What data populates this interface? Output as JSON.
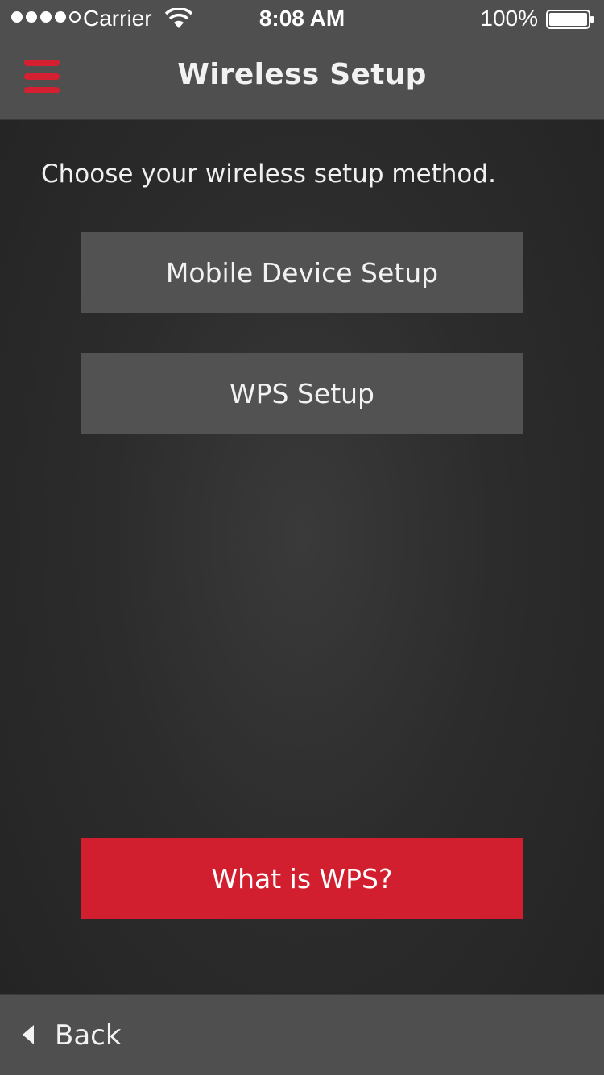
{
  "status_bar": {
    "carrier": "Carrier",
    "time": "8:08 AM",
    "battery": "100%",
    "signal_bars_filled": 4,
    "signal_bars_total": 5
  },
  "nav": {
    "title": "Wireless Setup",
    "menu_icon": "hamburger-menu-icon"
  },
  "content": {
    "instruction": "Choose your wireless setup method.",
    "mobile_setup_label": "Mobile Device Setup",
    "wps_setup_label": "WPS Setup",
    "what_is_wps_label": "What is WPS?"
  },
  "footer": {
    "back_label": "Back",
    "back_icon": "chevron-left-icon"
  },
  "colors": {
    "accent": "#d21f2f",
    "bar_gray": "#4f4f4f",
    "button_gray": "#525252",
    "background": "#2c2c2c"
  }
}
